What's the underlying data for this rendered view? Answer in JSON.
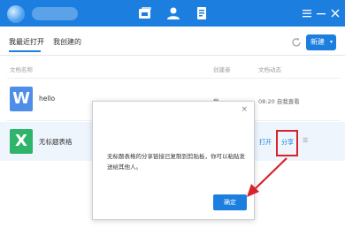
{
  "tabs": [
    {
      "label": "我最近打开"
    },
    {
      "label": "我创建的"
    }
  ],
  "toolbar": {
    "new_label": "新建",
    "new_caret": "▾"
  },
  "columns": {
    "name": "文档名称",
    "creator": "创建者",
    "time": "文档动态"
  },
  "files": [
    {
      "icon_letter": "W",
      "icon_color": "#4e8ee8",
      "name": "hello",
      "creator": "我",
      "time": "08:20 自我查看"
    },
    {
      "icon_letter": "X",
      "icon_color": "#2fb46b",
      "name": "无标题表格",
      "creator": "",
      "time": ""
    }
  ],
  "row_actions": {
    "open": "打开",
    "share": "分享",
    "more": "☰"
  },
  "dialog": {
    "close": "×",
    "message": "无标题表格的分享链接已复制到剪贴板，你可以粘贴发送给其他人。",
    "ok_label": "确定"
  },
  "colors": {
    "accent": "#1c7fe0",
    "highlight": "#d7232a"
  }
}
